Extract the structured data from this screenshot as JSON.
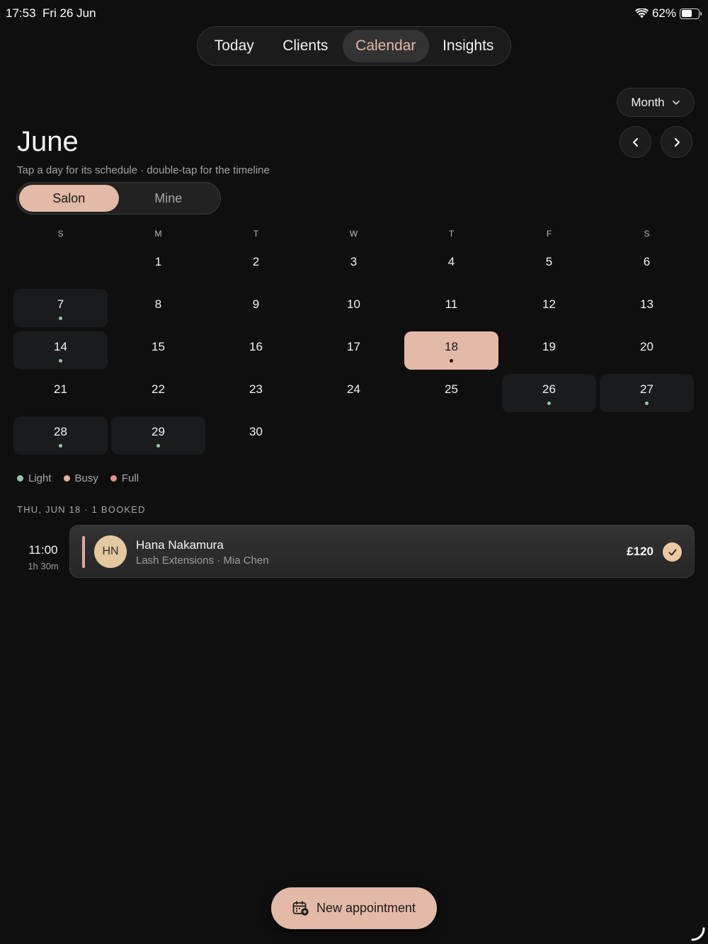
{
  "status": {
    "time": "17:53",
    "date": "Fri 26 Jun",
    "battery": "62%",
    "battery_level": 0.62
  },
  "nav": {
    "tabs": [
      "Today",
      "Clients",
      "Calendar",
      "Insights"
    ],
    "active": "Calendar"
  },
  "view_selector": {
    "label": "Month",
    "icon": "chevron-down-icon"
  },
  "header": {
    "title": "June",
    "subtitle": "Tap a day for its schedule · double-tap for the timeline"
  },
  "scope": {
    "options": [
      "Salon",
      "Mine"
    ],
    "active": "Salon"
  },
  "calendar": {
    "weekdays": [
      "S",
      "M",
      "T",
      "W",
      "T",
      "F",
      "S"
    ],
    "days": [
      {
        "n": "1"
      },
      {
        "n": "2"
      },
      {
        "n": "3"
      },
      {
        "n": "4"
      },
      {
        "n": "5"
      },
      {
        "n": "6"
      },
      {
        "n": "7",
        "load": "light"
      },
      {
        "n": "8"
      },
      {
        "n": "9"
      },
      {
        "n": "10"
      },
      {
        "n": "11"
      },
      {
        "n": "12"
      },
      {
        "n": "13"
      },
      {
        "n": "14",
        "load": "light"
      },
      {
        "n": "15"
      },
      {
        "n": "16"
      },
      {
        "n": "17"
      },
      {
        "n": "18",
        "load": "light",
        "selected": true
      },
      {
        "n": "19"
      },
      {
        "n": "20"
      },
      {
        "n": "21"
      },
      {
        "n": "22"
      },
      {
        "n": "23"
      },
      {
        "n": "24"
      },
      {
        "n": "25"
      },
      {
        "n": "26",
        "load": "light"
      },
      {
        "n": "27",
        "load": "light"
      },
      {
        "n": "28",
        "load": "light"
      },
      {
        "n": "29",
        "load": "light"
      },
      {
        "n": "30"
      }
    ],
    "first_weekday_index": 1
  },
  "legend": [
    {
      "label": "Light",
      "color": "#8fc7a8"
    },
    {
      "label": "Busy",
      "color": "#e7b39b"
    },
    {
      "label": "Full",
      "color": "#e3908b"
    }
  ],
  "day_section": {
    "heading": "THU, JUN 18 · 1 BOOKED"
  },
  "appointment": {
    "start": "11:00",
    "duration": "1h 30m",
    "initials": "HN",
    "client": "Hana Nakamura",
    "details": "Lash Extensions · Mia Chen",
    "price": "£120",
    "status_icon": "checkmark-icon"
  },
  "fab": {
    "label": "New appointment",
    "icon": "calendar-add-icon"
  },
  "colors": {
    "accent": "#e3b9a7",
    "background": "#0f0f0f",
    "light_dot": "#8fc7a8"
  }
}
